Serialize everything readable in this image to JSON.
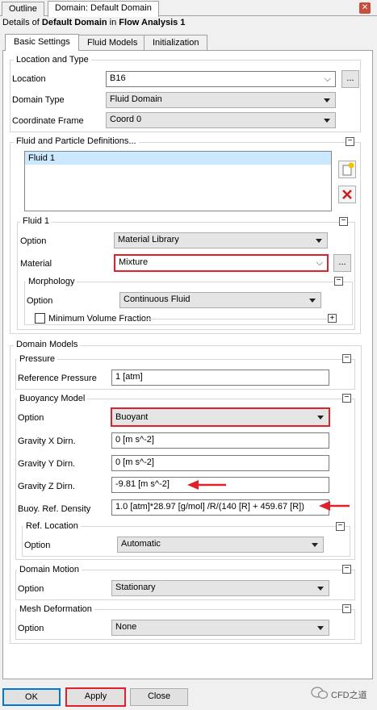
{
  "tabs": [
    "Outline",
    "Domain: Default Domain"
  ],
  "details": {
    "prefix": "Details of ",
    "object": "Default Domain",
    "middle": " in ",
    "analysis": "Flow Analysis 1"
  },
  "inner_tabs": [
    "Basic Settings",
    "Fluid Models",
    "Initialization"
  ],
  "location_type": {
    "title": "Location and Type",
    "location_label": "Location",
    "location_value": "B16",
    "browse_label": "...",
    "domain_type_label": "Domain Type",
    "domain_type_value": "Fluid Domain",
    "coord_label": "Coordinate Frame",
    "coord_value": "Coord 0"
  },
  "fluid_defs": {
    "title": "Fluid and Particle Definitions...",
    "items": [
      "Fluid 1"
    ],
    "fluid1": {
      "title": "Fluid 1",
      "option_label": "Option",
      "option_value": "Material Library",
      "material_label": "Material",
      "material_value": "Mixture",
      "browse_label": "...",
      "morphology": {
        "title": "Morphology",
        "option_label": "Option",
        "option_value": "Continuous Fluid",
        "min_vol_label": "Minimum Volume Fraction"
      }
    }
  },
  "domain_models": {
    "title": "Domain Models",
    "pressure": {
      "title": "Pressure",
      "ref_label": "Reference Pressure",
      "ref_value": "1 [atm]"
    },
    "buoyancy": {
      "title": "Buoyancy Model",
      "option_label": "Option",
      "option_value": "Buoyant",
      "gx_label": "Gravity X Dirn.",
      "gx_value": "0 [m s^-2]",
      "gy_label": "Gravity Y Dirn.",
      "gy_value": "0 [m s^-2]",
      "gz_label": "Gravity Z Dirn.",
      "gz_value": "-9.81 [m s^-2]",
      "density_label": "Buoy. Ref. Density",
      "density_value": "1.0 [atm]*28.97 [g/mol] /R/(140 [R] + 459.67 [R])",
      "ref_location": {
        "title": "Ref. Location",
        "option_label": "Option",
        "option_value": "Automatic"
      }
    },
    "motion": {
      "title": "Domain Motion",
      "option_label": "Option",
      "option_value": "Stationary"
    },
    "mesh": {
      "title": "Mesh Deformation",
      "option_label": "Option",
      "option_value": "None"
    }
  },
  "buttons": {
    "ok": "OK",
    "apply": "Apply",
    "close": "Close"
  },
  "watermark": "CFD之道",
  "colors": {
    "highlight": "#e0202a",
    "selection": "#cce8ff",
    "ok_border": "#0078d7"
  }
}
